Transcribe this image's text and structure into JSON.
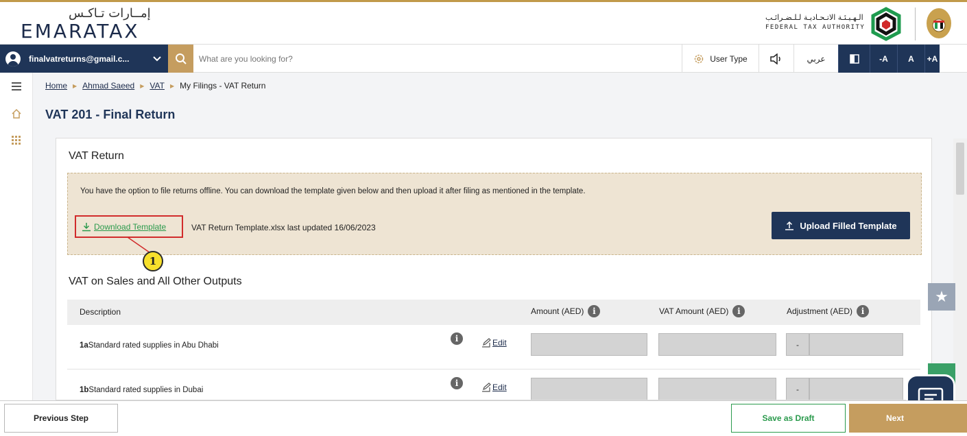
{
  "header": {
    "logo_arabic": "إمــارات تـاكـس",
    "logo_english": "EMARATAX",
    "fta_arabic": "الـهـيـئـة الاتـحـاديـة لـلـضـرائـب",
    "fta_english": "FEDERAL TAX AUTHORITY",
    "fta_logo_icon": "fta-logo-icon",
    "emblem_icon": "uae-emblem-icon",
    "accent_color": "#c19a4b"
  },
  "navbar": {
    "user_email": "finalvatreturns@gmail.c...",
    "search_placeholder": "What are you looking for?",
    "user_type_label": "User Type",
    "arabic_label": "عربي",
    "font_decrease": "-A",
    "font_normal": "A",
    "font_increase": "+A",
    "brand_color": "#1f3558"
  },
  "breadcrumb": {
    "items": [
      "Home",
      "Ahmad Saeed",
      "VAT"
    ],
    "current": "My Filings - VAT Return"
  },
  "page": {
    "title": "VAT 201 - Final Return"
  },
  "vat_return": {
    "title": "VAT Return",
    "notice": "You have the option to file returns offline. You can download the template given below and then upload it after filing as mentioned in the template.",
    "download_label": "Download Template",
    "template_info": "VAT Return Template.xlsx last updated 16/06/2023",
    "upload_label": "Upload Filled Template",
    "callout_number": "1"
  },
  "sales_section": {
    "title": "VAT on Sales and All Other Outputs",
    "columns": {
      "description": "Description",
      "amount": "Amount (AED)",
      "vat_amount": "VAT Amount (AED)",
      "adjustment": "Adjustment (AED)"
    },
    "rows": [
      {
        "code": "1a",
        "label": "Standard rated supplies in Abu Dhabi",
        "edit": "Edit",
        "adjustment_sign": "-"
      },
      {
        "code": "1b",
        "label": "Standard rated supplies in Dubai",
        "edit": "Edit",
        "adjustment_sign": "-"
      }
    ]
  },
  "footer": {
    "previous_label": "Previous Step",
    "draft_label": "Save as Draft",
    "next_label": "Next"
  }
}
